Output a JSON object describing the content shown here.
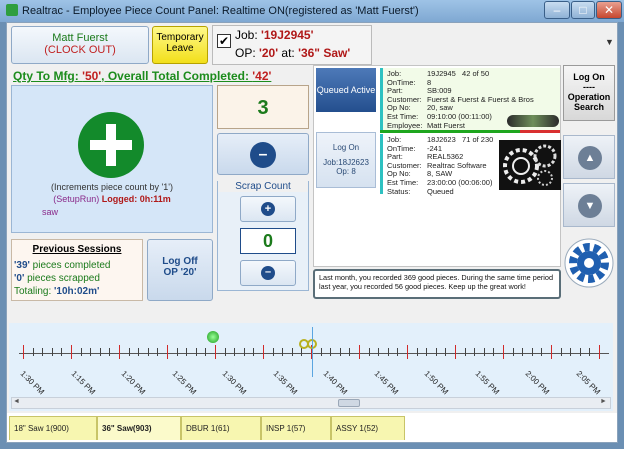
{
  "window": {
    "title": "Realtrac - Employee Piece Count Panel: Realtime ON(registered as 'Matt Fuerst')",
    "minimize": "–",
    "maximize": "□",
    "close": "✕"
  },
  "top": {
    "user_name": "Matt Fuerst",
    "clock_out": "(CLOCK OUT)",
    "leave_line1": "Temporary",
    "leave_line2": "Leave",
    "job_prefix": "Job: ",
    "job_value": "'19J2945'",
    "op_prefix": "OP: ",
    "op_value": "'20'",
    "at_label": " at: ",
    "machine_value": "'36\" Saw'",
    "checkbox_mark": "✔",
    "dropdown_arrow": "▼"
  },
  "qty": {
    "prefix": "Qty To Mfg: ",
    "mfg_value": "'50'",
    "mid": ", Overall Total Completed: ",
    "completed_value": "'42'"
  },
  "increment": {
    "plus_icon": "plus",
    "desc": "(Increments piece count by '1')",
    "setup": "(SetupRun) ",
    "logged": "Logged: 0h:11m",
    "machine": "saw"
  },
  "count": {
    "value": "3"
  },
  "scrap": {
    "title": "Scrap Count",
    "value": "0",
    "plus_glyph": "+",
    "minus_glyph": "–"
  },
  "minus_glyph": "–",
  "previous": {
    "title": "Previous Sessions",
    "line1_val": "'39'",
    "line1_txt": " pieces completed",
    "line2_val": "'0'",
    "line2_txt": " pieces scrapped",
    "line3_txt": "Totaling: ",
    "line3_val": "'10h:02m'"
  },
  "logoff": {
    "line1": "Log Off",
    "line2": "OP '20'"
  },
  "queue": {
    "active_label": "Queued Active",
    "logon_line1": "Log On",
    "logon_line2": "Job:18J2623",
    "logon_line3": "Op: 8",
    "job1": {
      "job_k": "Job:",
      "job_v": "19J2945",
      "job_extra": "42 of 50",
      "ontime_k": "OnTime:",
      "ontime_v": "8",
      "part_k": "Part:",
      "part_v": "SB:009",
      "cust_k": "Customer:",
      "cust_v": "Fuerst & Fuerst & Fuerst & Bros",
      "op_k": "Op No:",
      "op_v": "20, saw",
      "est_k": "Est Time:",
      "est_v": "09:10:00 (00:11:00)",
      "emp_k": "Employee:",
      "emp_v": "Matt Fuerst"
    },
    "job2": {
      "job_k": "Job:",
      "job_v": "18J2623",
      "job_extra": "71 of 230",
      "ontime_k": "OnTime:",
      "ontime_v": "-241",
      "part_k": "Part:",
      "part_v": "REAL5362",
      "cust_k": "Customer:",
      "cust_v": "Realtrac Software",
      "op_k": "Op No:",
      "op_v": "8, SAW",
      "est_k": "Est Time:",
      "est_v": "23:00:00 (00:06:00)",
      "status_k": "Status:",
      "status_v": "Queued"
    }
  },
  "right": {
    "logon_line1": "Log On",
    "logon_line2": "----",
    "logon_line3": "Operation",
    "logon_line4": "Search",
    "up_icon": "chevron-up-icon",
    "down_icon": "chevron-down-icon",
    "gear_icon": "gear-icon"
  },
  "message": "Last month, you recorded 369 good pieces. During the same time period last year, you recorded 56 good pieces. Keep up the great work!",
  "timeline": {
    "ticks": [
      "1:30 PM",
      "1:15 PM",
      "1:20 PM",
      "1:25 PM",
      "1:30 PM",
      "1:35 PM",
      "1:40 PM",
      "1:45 PM",
      "1:50 PM",
      "1:55 PM",
      "2:00 PM",
      "2:05 PM"
    ],
    "scroll_left": "◄",
    "scroll_right": "►"
  },
  "tabs": [
    "18\" Saw 1(900)",
    "36\" Saw(903)",
    "DBUR 1(61)",
    "INSP 1(57)",
    "ASSY 1(52)"
  ],
  "colors": {
    "accent_green": "#138a2b",
    "accent_red": "#c02020",
    "accent_blue": "#1f4c8a"
  }
}
